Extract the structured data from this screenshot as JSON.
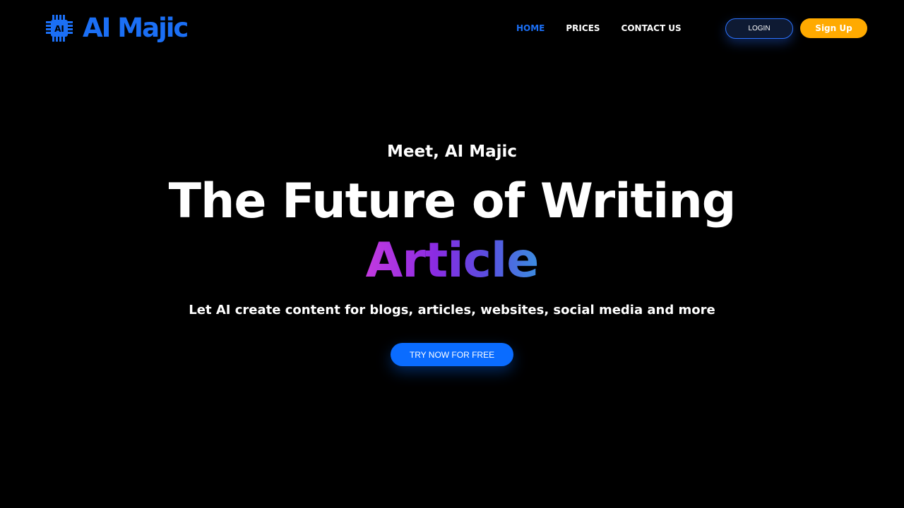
{
  "brand": {
    "name": "AI Majic",
    "chip_label": "AI",
    "color": "#1b6ff5"
  },
  "nav": {
    "home": "HOME",
    "prices": "PRICES",
    "contact": "CONTACT US",
    "active": "home",
    "active_color": "#1b6ff5"
  },
  "auth": {
    "login": "LOGIN",
    "signup": "Sign Up",
    "signup_color": "#ffaa00"
  },
  "hero": {
    "eyebrow": "Meet, AI Majic",
    "headline": "The Future of Writing",
    "accent": "Article",
    "subline": "Let AI create content for blogs, articles, websites, social media and more",
    "cta": "TRY NOW FOR FREE",
    "cta_color": "#0a6cff"
  },
  "icons": {
    "logo": "chip-icon"
  }
}
